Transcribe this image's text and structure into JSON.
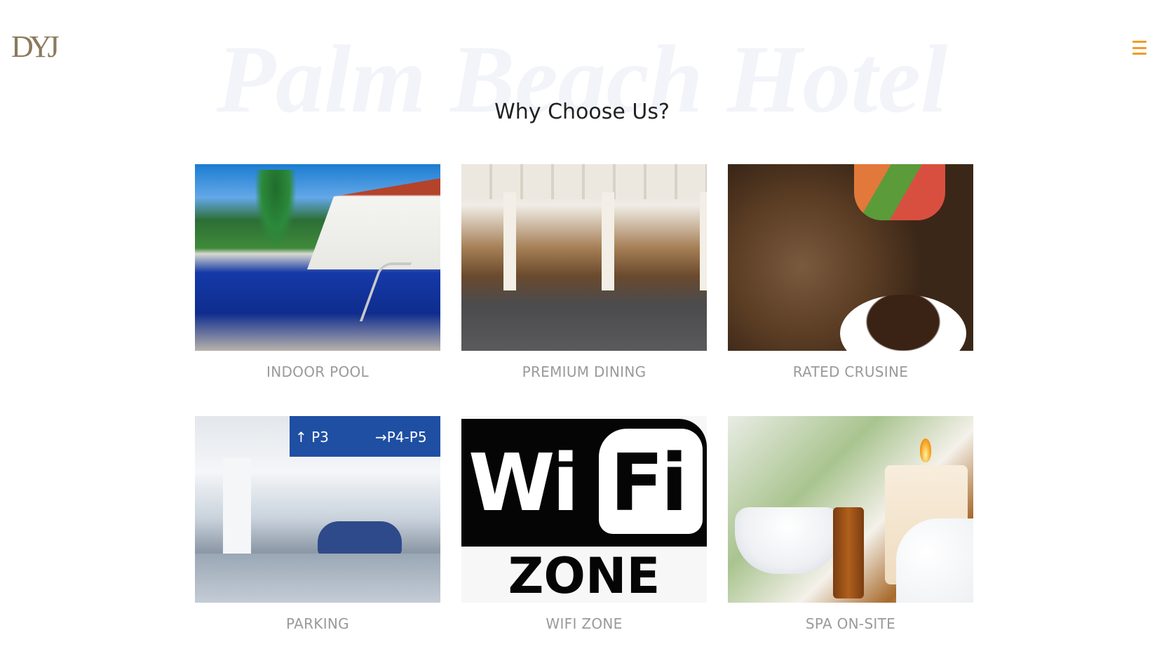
{
  "header": {
    "logo_text": "DYJ",
    "watermark": "Palm Beach Hotel",
    "menu_icon": "hamburger-icon"
  },
  "section": {
    "title": "Why Choose Us?"
  },
  "features": [
    {
      "label": "INDOOR POOL",
      "image": "pool-photo"
    },
    {
      "label": "PREMIUM DINING",
      "image": "dining-room-photo"
    },
    {
      "label": "RATED CRUSINE",
      "image": "grilled-meat-photo"
    },
    {
      "label": "PARKING",
      "image": "parking-garage-photo"
    },
    {
      "label": "WIFI ZONE",
      "image": "wifi-zone-sign"
    },
    {
      "label": "SPA ON-SITE",
      "image": "spa-candle-photo"
    }
  ],
  "images_text": {
    "parking_sign_left": "↑ P3",
    "parking_sign_right": "→P4-P5",
    "wifi_left": "Wi",
    "wifi_right": "Fi",
    "wifi_zone": "ZONE"
  },
  "colors": {
    "accent": "#f39b26",
    "watermark": "#f2f4f9",
    "label": "#9a9a9a",
    "title": "#222222",
    "logo": "#8a7a5c"
  }
}
